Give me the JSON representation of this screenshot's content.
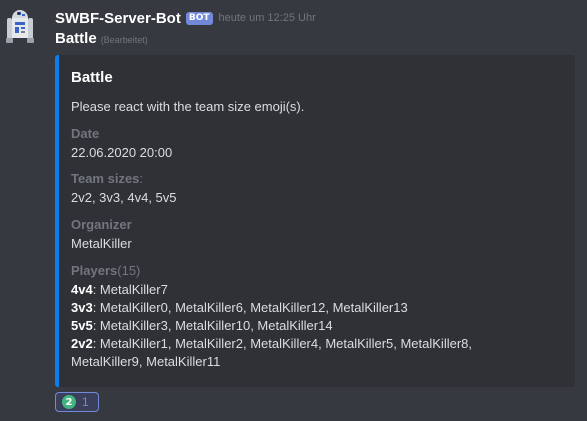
{
  "message": {
    "author": "SWBF-Server-Bot",
    "badge": "BOT",
    "timestamp": "heute um 12:25 Uhr",
    "content": "Battle",
    "edited": "(Bearbeitet)"
  },
  "embed": {
    "accent_color": "#0b7fe8",
    "title": "Battle",
    "description": "Please react with the team size emoji(s).",
    "fields": {
      "date": {
        "name": "Date",
        "value": "22.06.2020 20:00"
      },
      "team_sizes": {
        "name": "Team sizes",
        "name_suffix": ":",
        "value": "2v2, 3v3, 4v4, 5v5"
      },
      "organizer": {
        "name": "Organizer",
        "value": "MetalKiller"
      },
      "players": {
        "name": "Players",
        "count": "(15)",
        "lines": [
          {
            "size": "4v4",
            "players": ": MetalKiller7"
          },
          {
            "size": "3v3",
            "players": ": MetalKiller0, MetalKiller6, MetalKiller12, MetalKiller13"
          },
          {
            "size": "5v5",
            "players": ": MetalKiller3, MetalKiller10, MetalKiller14"
          },
          {
            "size": "2v2",
            "players": ": MetalKiller1, MetalKiller2, MetalKiller4, MetalKiller5, MetalKiller8,"
          },
          {
            "size": "",
            "players": "MetalKiller9, MetalKiller11"
          }
        ]
      }
    }
  },
  "reaction": {
    "emoji": "2",
    "emoji_name": "keycap-two-icon",
    "count": "1"
  }
}
